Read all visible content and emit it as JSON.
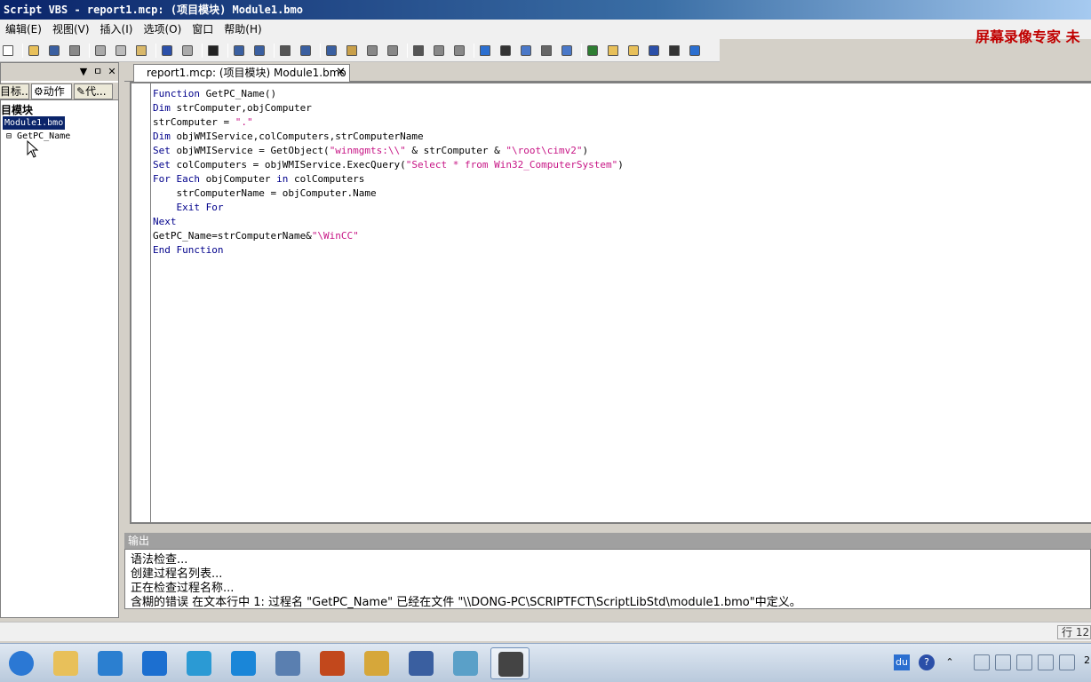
{
  "window": {
    "title": "Script VBS - report1.mcp: (项目模块) Module1.bmo",
    "watermark": "屏幕录像专家 未"
  },
  "menu": [
    "编辑(E)",
    "视图(V)",
    "插入(I)",
    "选项(O)",
    "窗口",
    "帮助(H)"
  ],
  "toolbar_icons": [
    "new-icon",
    "open-icon",
    "save-icon",
    "print-icon",
    "cut-icon",
    "copy-icon",
    "paste-icon",
    "undo-icon",
    "redo-icon",
    "help-pointer-icon",
    "indent-icon",
    "outdent-icon",
    "align-icon",
    "wrap-icon",
    "draw-icon",
    "tool-icon",
    "edit-tool-icon",
    "syntax-icon",
    "find-icon",
    "replace-icon",
    "compile-icon",
    "info-icon",
    "output-icon",
    "database-icon",
    "calc-icon",
    "run-icon",
    "script-icon",
    "folder-icon",
    "toolbox-icon",
    "action-icon",
    "pen-icon",
    "clock-icon"
  ],
  "left_panel": {
    "header_controls": [
      "▼",
      "ㅁ",
      "✕"
    ],
    "tabs": [
      "目标...",
      "动作",
      "代..."
    ],
    "tree_root": "目模块",
    "tree_selected": "Module1.bmo",
    "tree_item": "GetPC_Name"
  },
  "editor": {
    "tab_title": "report1.mcp: (项目模块) Module1.bmo",
    "tab_close": "✕",
    "lines": [
      [
        {
          "t": "kw",
          "v": "Function"
        },
        {
          "t": "n",
          "v": " GetPC_Name()"
        }
      ],
      [
        {
          "t": "kw",
          "v": "Dim"
        },
        {
          "t": "n",
          "v": " strComputer,objComputer"
        }
      ],
      [
        {
          "t": "n",
          "v": "strComputer = "
        },
        {
          "t": "str",
          "v": "\".\""
        }
      ],
      [
        {
          "t": "kw",
          "v": "Dim"
        },
        {
          "t": "n",
          "v": " objWMIService,colComputers,strComputerName"
        }
      ],
      [
        {
          "t": "kw",
          "v": "Set"
        },
        {
          "t": "n",
          "v": " objWMIService = GetObject("
        },
        {
          "t": "str",
          "v": "\"winmgmts:\\\\\""
        },
        {
          "t": "n",
          "v": " & strComputer & "
        },
        {
          "t": "str",
          "v": "\"\\root\\cimv2\""
        },
        {
          "t": "n",
          "v": ")"
        }
      ],
      [
        {
          "t": "kw",
          "v": "Set"
        },
        {
          "t": "n",
          "v": " colComputers = objWMIService.ExecQuery("
        },
        {
          "t": "str",
          "v": "\"Select * from Win32_ComputerSystem\""
        },
        {
          "t": "n",
          "v": ")"
        }
      ],
      [
        {
          "t": "kw",
          "v": "For Each"
        },
        {
          "t": "n",
          "v": " objComputer "
        },
        {
          "t": "kw",
          "v": "in"
        },
        {
          "t": "n",
          "v": " colComputers"
        }
      ],
      [
        {
          "t": "n",
          "v": "    strComputerName = objComputer.Name"
        }
      ],
      [
        {
          "t": "kw",
          "v": "    Exit For"
        }
      ],
      [
        {
          "t": "kw",
          "v": "Next"
        }
      ],
      [
        {
          "t": "n",
          "v": "GetPC_Name=strComputerName&"
        },
        {
          "t": "str",
          "v": "\"\\WinCC\""
        }
      ],
      [
        {
          "t": "kw",
          "v": "End Function"
        }
      ]
    ]
  },
  "output": {
    "title": "输出",
    "lines": [
      "语法检查...",
      "创建过程名列表...",
      "正在检查过程名称...",
      "含糊的错误 在文本行中 1: 过程名 \"GetPC_Name\" 已经在文件 \"\\\\DONG-PC\\SCRIPTFCT\\ScriptLibStd\\module1.bmo\"中定义。"
    ]
  },
  "status": {
    "position": "行 12,"
  },
  "taskbar": {
    "apps": [
      "ie-icon",
      "explorer-icon",
      "messenger-icon",
      "grid-app-icon",
      "network-app-icon",
      "chat-app-icon",
      "wincc-icon",
      "powerpoint-icon",
      "tools-icon",
      "graphics-icon",
      "editor-app-icon",
      "vbs-icon"
    ],
    "tray": [
      "du",
      "?",
      "⌃"
    ],
    "clock": "2"
  },
  "colors": {
    "keyword": "#00008b",
    "string": "#c71585",
    "watermark": "#c00000"
  }
}
